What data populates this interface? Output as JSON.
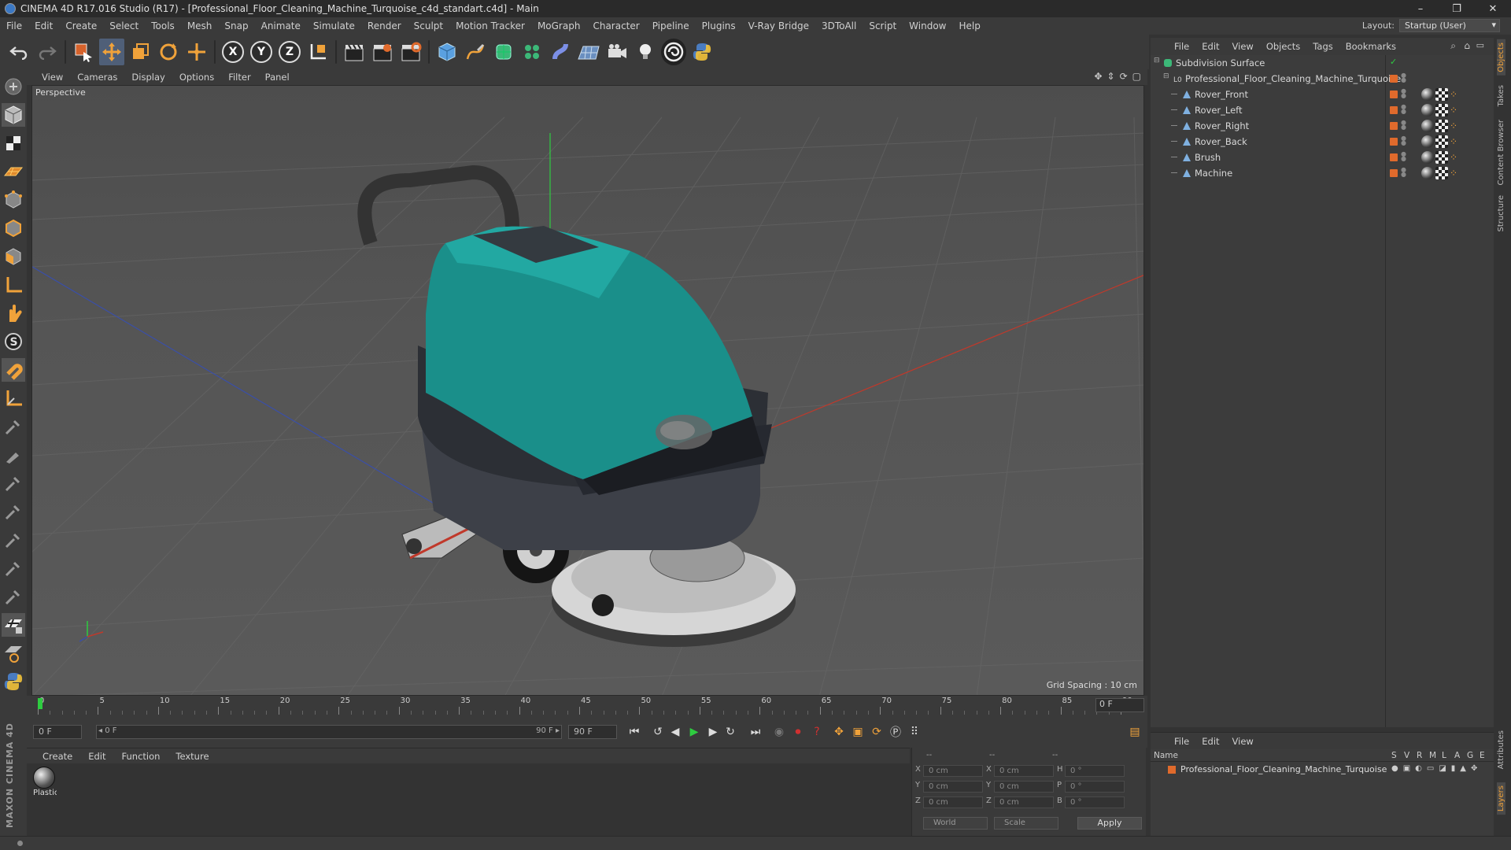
{
  "window": {
    "title": "CINEMA 4D R17.016 Studio (R17) - [Professional_Floor_Cleaning_Machine_Turquoise_c4d_standart.c4d] - Main",
    "minimize": "–",
    "restore": "❐",
    "close": "✕"
  },
  "menu": [
    "File",
    "Edit",
    "Create",
    "Select",
    "Tools",
    "Mesh",
    "Snap",
    "Animate",
    "Simulate",
    "Render",
    "Sculpt",
    "Motion Tracker",
    "MoGraph",
    "Character",
    "Pipeline",
    "Plugins",
    "V-Ray Bridge",
    "3DToAll",
    "Script",
    "Window",
    "Help"
  ],
  "layout": {
    "label": "Layout:",
    "value": "Startup (User)"
  },
  "viewport": {
    "menu": [
      "View",
      "Cameras",
      "Display",
      "Options",
      "Filter",
      "Panel"
    ],
    "camera_label": "Perspective",
    "grid_spacing": "Grid Spacing : 10 cm"
  },
  "timeline": {
    "ticks": [
      "0",
      "5",
      "10",
      "15",
      "20",
      "25",
      "30",
      "35",
      "40",
      "45",
      "50",
      "55",
      "60",
      "65",
      "70",
      "75",
      "80",
      "85",
      "90"
    ],
    "current_frame": "0 F"
  },
  "playback": {
    "start_field": "0 F",
    "range_start": "◂ 0 F",
    "range_end": "90 F ▸",
    "end_field": "90 F"
  },
  "material_manager": {
    "menu": [
      "Create",
      "Edit",
      "Function",
      "Texture"
    ],
    "materials": [
      {
        "name": "Plastic"
      }
    ]
  },
  "coordinates": {
    "header": [
      "--",
      "--",
      "--"
    ],
    "rows": [
      {
        "l1": "X",
        "v1": "0 cm",
        "l2": "X",
        "v2": "0 cm",
        "l3": "H",
        "v3": "0 °"
      },
      {
        "l1": "Y",
        "v1": "0 cm",
        "l2": "Y",
        "v2": "0 cm",
        "l3": "P",
        "v3": "0 °"
      },
      {
        "l1": "Z",
        "v1": "0 cm",
        "l2": "Z",
        "v2": "0 cm",
        "l3": "B",
        "v3": "0 °"
      }
    ],
    "world_select": "World",
    "scale_select": "Scale",
    "apply": "Apply"
  },
  "object_manager": {
    "menu": [
      "File",
      "Edit",
      "View",
      "Objects",
      "Tags",
      "Bookmarks"
    ],
    "objects": [
      {
        "name": "Subdivision Surface",
        "level": 0,
        "type": "subdivision"
      },
      {
        "name": "Professional_Floor_Cleaning_Machine_Turquoise",
        "level": 1,
        "type": "null"
      },
      {
        "name": "Rover_Front",
        "level": 2,
        "type": "mesh"
      },
      {
        "name": "Rover_Left",
        "level": 2,
        "type": "mesh"
      },
      {
        "name": "Rover_Right",
        "level": 2,
        "type": "mesh"
      },
      {
        "name": "Rover_Back",
        "level": 2,
        "type": "mesh"
      },
      {
        "name": "Brush",
        "level": 2,
        "type": "mesh"
      },
      {
        "name": "Machine",
        "level": 2,
        "type": "mesh"
      }
    ]
  },
  "layer_manager": {
    "menu": [
      "File",
      "Edit",
      "View"
    ],
    "columns": [
      "Name",
      "S",
      "V",
      "R",
      "M",
      "L",
      "A",
      "G",
      "E"
    ],
    "layers": [
      {
        "name": "Professional_Floor_Cleaning_Machine_Turquoise",
        "color": "#e06a2c"
      }
    ]
  },
  "right_tabs": [
    "Objects",
    "Takes",
    "Content Browser",
    "Structure",
    "Attributes",
    "Layers"
  ],
  "brand": "MAXON CINEMA 4D",
  "colors": {
    "accent": "#e06a2c",
    "turquoise": "#1a8f8a",
    "x_axis": "#c0392b",
    "z_axis": "#3a4fa8",
    "y_axis": "#2ecc40"
  }
}
